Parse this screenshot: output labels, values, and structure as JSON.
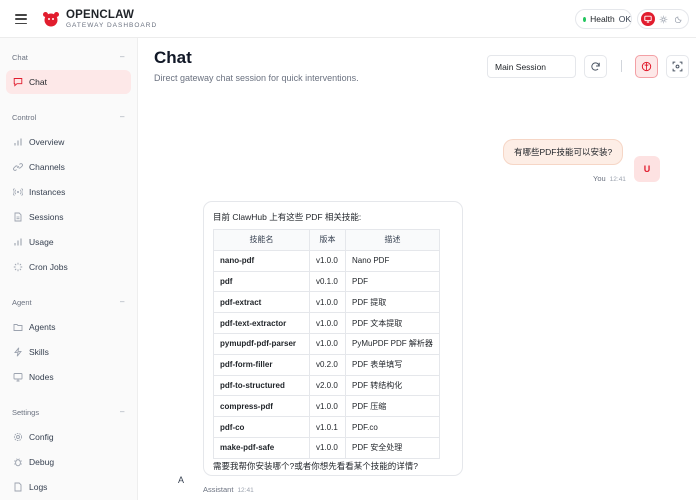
{
  "header": {
    "brand_title": "OPENCLAW",
    "brand_subtitle": "GATEWAY DASHBOARD",
    "health_label": "Health",
    "health_status": "OK",
    "accent_color": "#e11d2e",
    "status_color": "#22c55e"
  },
  "sidebar": {
    "sections": [
      {
        "label": "Chat",
        "items": [
          {
            "label": "Chat",
            "icon": "message-square-icon",
            "active": true
          }
        ]
      },
      {
        "label": "Control",
        "items": [
          {
            "label": "Overview",
            "icon": "bar-chart-icon"
          },
          {
            "label": "Channels",
            "icon": "link-icon"
          },
          {
            "label": "Instances",
            "icon": "radio-icon"
          },
          {
            "label": "Sessions",
            "icon": "file-text-icon"
          },
          {
            "label": "Usage",
            "icon": "bar-chart-icon"
          },
          {
            "label": "Cron Jobs",
            "icon": "loader-icon"
          }
        ]
      },
      {
        "label": "Agent",
        "items": [
          {
            "label": "Agents",
            "icon": "folder-icon"
          },
          {
            "label": "Skills",
            "icon": "zap-icon"
          },
          {
            "label": "Nodes",
            "icon": "monitor-icon"
          }
        ]
      },
      {
        "label": "Settings",
        "items": [
          {
            "label": "Config",
            "icon": "settings-icon"
          },
          {
            "label": "Debug",
            "icon": "bug-icon"
          },
          {
            "label": "Logs",
            "icon": "file-icon"
          }
        ]
      }
    ]
  },
  "main": {
    "title": "Chat",
    "description": "Direct gateway chat session for quick interventions.",
    "session_select": "Main Session"
  },
  "messages": {
    "user": {
      "text": "有哪些PDF技能可以安装?",
      "avatar": "U",
      "sender": "You",
      "time": "12:41"
    },
    "assistant": {
      "intro": "目前 ClawHub 上有这些 PDF 相关技能:",
      "table": {
        "headers": [
          "技能名",
          "版本",
          "描述"
        ],
        "rows": [
          [
            "nano-pdf",
            "v1.0.0",
            "Nano PDF"
          ],
          [
            "pdf",
            "v0.1.0",
            "PDF"
          ],
          [
            "pdf-extract",
            "v1.0.0",
            "PDF 提取"
          ],
          [
            "pdf-text-extractor",
            "v1.0.0",
            "PDF 文本提取"
          ],
          [
            "pymupdf-pdf-parser",
            "v1.0.0",
            "PyMuPDF PDF 解析器"
          ],
          [
            "pdf-form-filler",
            "v0.2.0",
            "PDF 表单填写"
          ],
          [
            "pdf-to-structured",
            "v2.0.0",
            "PDF 转结构化"
          ],
          [
            "compress-pdf",
            "v1.0.0",
            "PDF 压缩"
          ],
          [
            "pdf-co",
            "v1.0.1",
            "PDF.co"
          ],
          [
            "make-pdf-safe",
            "v1.0.0",
            "PDF 安全处理"
          ]
        ]
      },
      "outro": "需要我帮你安装哪个?或者你想先看看某个技能的详情?",
      "avatar": "A",
      "sender": "Assistant",
      "time": "12:41"
    }
  }
}
